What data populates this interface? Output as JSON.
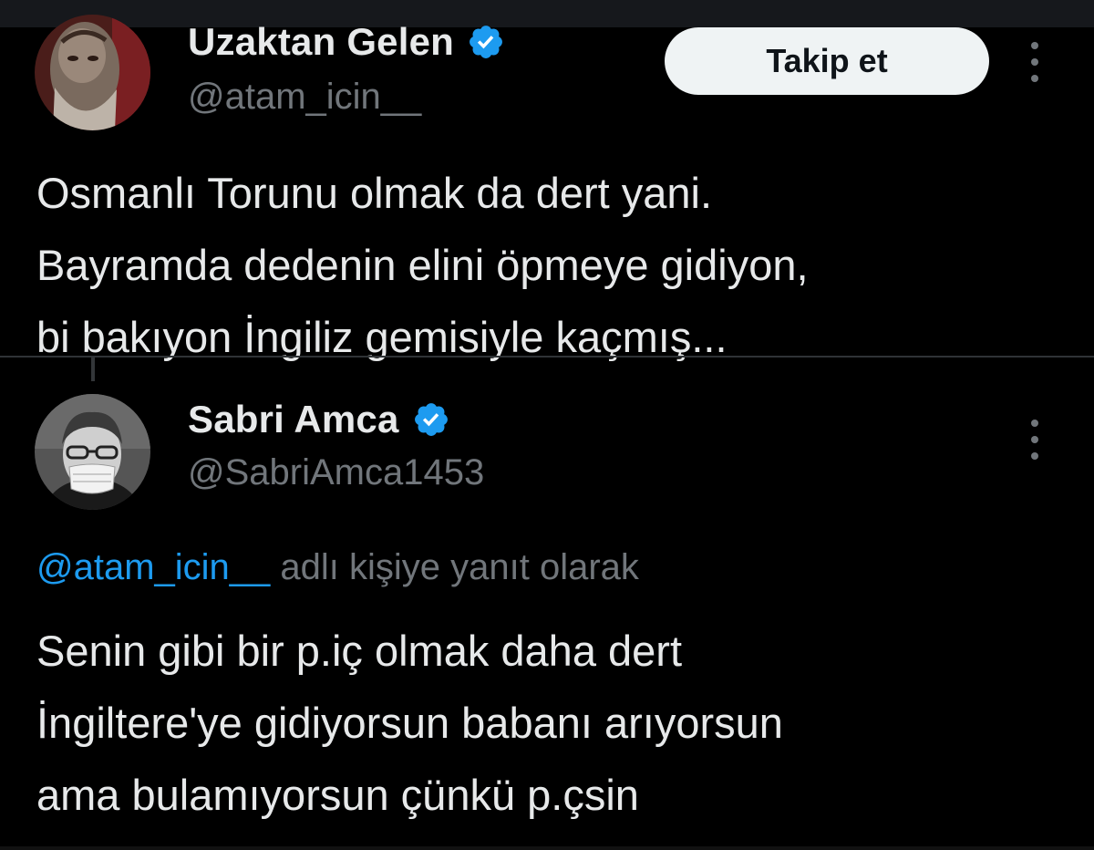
{
  "tweet1": {
    "display_name": "Uzaktan Gelen",
    "handle": "@atam_icin__",
    "follow_label": "Takip et",
    "avatar_icon": "portrait-avatar-icon",
    "text": "Osmanlı Torunu olmak da dert yani.\nBayramda dedenin elini öpmeye gidiyon,\nbi bakıyon İngiliz gemisiyle kaçmış..."
  },
  "tweet2": {
    "display_name": "Sabri Amca",
    "handle": "@SabriAmca1453",
    "avatar_icon": "masked-man-avatar-icon",
    "reply_mention": "@atam_icin__",
    "reply_suffix": " adlı kişiye yanıt olarak",
    "text": "Senin gibi bir p.iç olmak daha dert\nİngiltere'ye gidiyorsun babanı arıyorsun\nama bulamıyorsun çünkü p.çsin"
  },
  "colors": {
    "background": "#000000",
    "text_primary": "#e7e9ea",
    "text_secondary": "#71767b",
    "accent": "#1d9bf0",
    "verified": "#1d9bf0",
    "follow_bg": "#eff3f4"
  }
}
